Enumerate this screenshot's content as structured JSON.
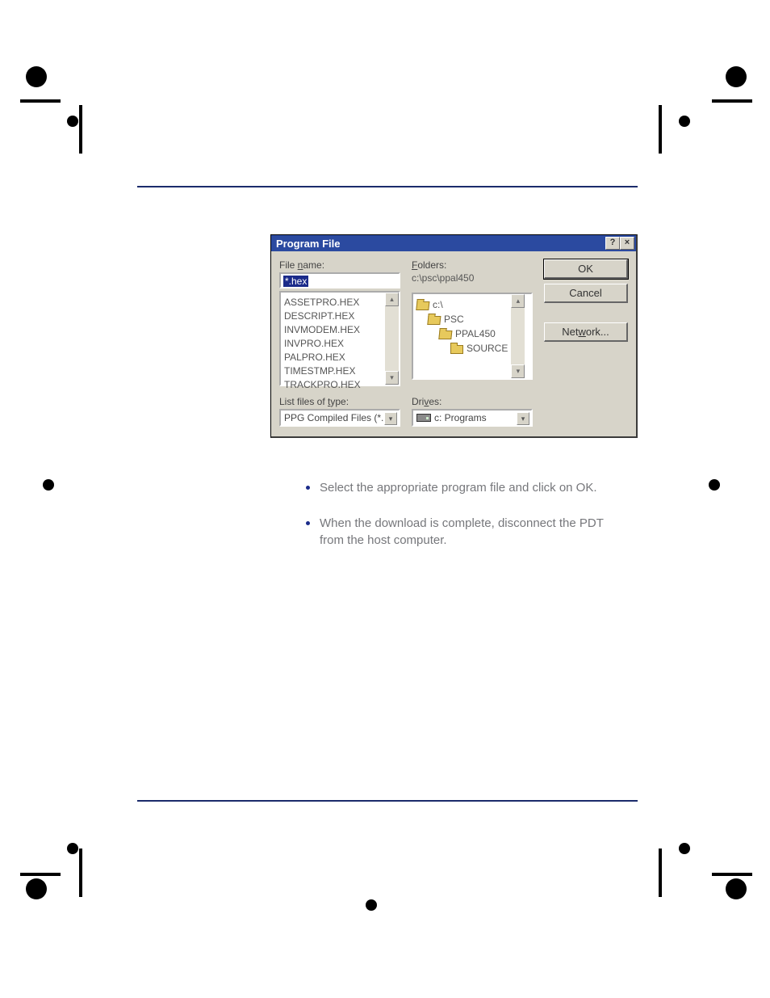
{
  "dialog": {
    "title": "Program File",
    "help_btn": "?",
    "close_btn": "×",
    "filename_label_prefix": "File ",
    "filename_label_ul": "n",
    "filename_label_suffix": "ame:",
    "filename_value": "*.hex",
    "file_list": [
      "ASSETPRO.HEX",
      "DESCRIPT.HEX",
      "INVMODEM.HEX",
      "INVPRO.HEX",
      "PALPRO.HEX",
      "TIMESTMP.HEX",
      "TRACKPRO.HEX"
    ],
    "folders_label_ul": "F",
    "folders_label_suffix": "olders:",
    "folders_path": "c:\\psc\\ppal450",
    "tree": [
      {
        "indent": 1,
        "open": true,
        "label": "c:\\"
      },
      {
        "indent": 2,
        "open": true,
        "label": "PSC"
      },
      {
        "indent": 3,
        "open": true,
        "label": "PPAL450"
      },
      {
        "indent": 4,
        "open": false,
        "label": "SOURCE"
      }
    ],
    "filetype_label_prefix": "List files of ",
    "filetype_label_ul": "t",
    "filetype_label_suffix": "ype:",
    "filetype_value": "PPG Compiled Files (*.H",
    "drives_label_prefix": "Dri",
    "drives_label_ul": "v",
    "drives_label_suffix": "es:",
    "drives_value": "c: Programs",
    "ok": "OK",
    "cancel": "Cancel",
    "network_prefix": "Net",
    "network_ul": "w",
    "network_suffix": "ork..."
  },
  "text": {
    "bullet1": "Select the appropriate program file and click on OK.",
    "bullet2": "When the download is complete, disconnect the PDT from the host computer."
  }
}
